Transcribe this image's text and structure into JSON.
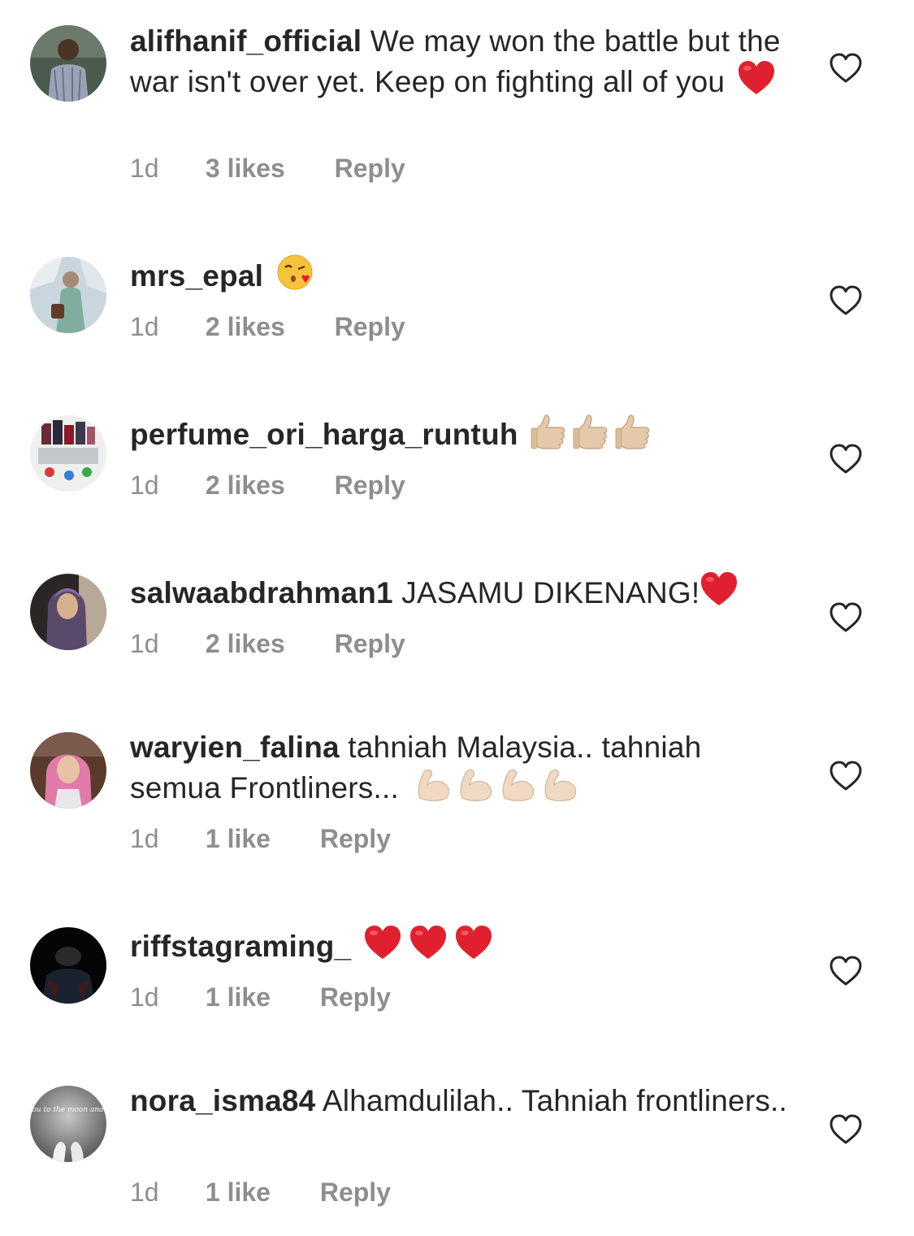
{
  "comments": [
    {
      "username": "alifhanif_official",
      "text": " We may won the battle but the war isn't over yet. Keep on fighting all of you",
      "emoji": "red-heart",
      "time": "1d",
      "likes": "3 likes",
      "reply": "Reply"
    },
    {
      "username": "mrs_epal",
      "text": "",
      "emoji": "face-blowing-kiss",
      "time": "1d",
      "likes": "2 likes",
      "reply": "Reply"
    },
    {
      "username": "perfume_ori_harga_runtuh",
      "text": "",
      "emoji": "thumbs-up x3",
      "time": "1d",
      "likes": "2 likes",
      "reply": "Reply"
    },
    {
      "username": "salwaabdrahman1",
      "text": " JASAMU DIKENANG!",
      "emoji": "red-heart",
      "time": "1d",
      "likes": "2 likes",
      "reply": "Reply"
    },
    {
      "username": "waryien_falina",
      "text": " tahniah Malaysia.. tahniah semua Frontliners...",
      "emoji": "flexed-biceps x4",
      "time": "1d",
      "likes": "1 like",
      "reply": "Reply"
    },
    {
      "username": "riffstagraming_",
      "text": "",
      "emoji": "red-heart x3",
      "time": "1d",
      "likes": "1 like",
      "reply": "Reply"
    },
    {
      "username": "nora_isma84",
      "text": " Alhamdulilah.. Tahniah frontliners..",
      "emoji": "",
      "time": "1d",
      "likes": "1 like",
      "reply": "Reply"
    }
  ],
  "avatar_captions": {
    "nora_isma84": "love you to the moon and back."
  },
  "colors": {
    "text": "#262626",
    "meta": "#8e8e8e",
    "heart_outline": "#262626",
    "emoji_heart": "#e0202e"
  }
}
